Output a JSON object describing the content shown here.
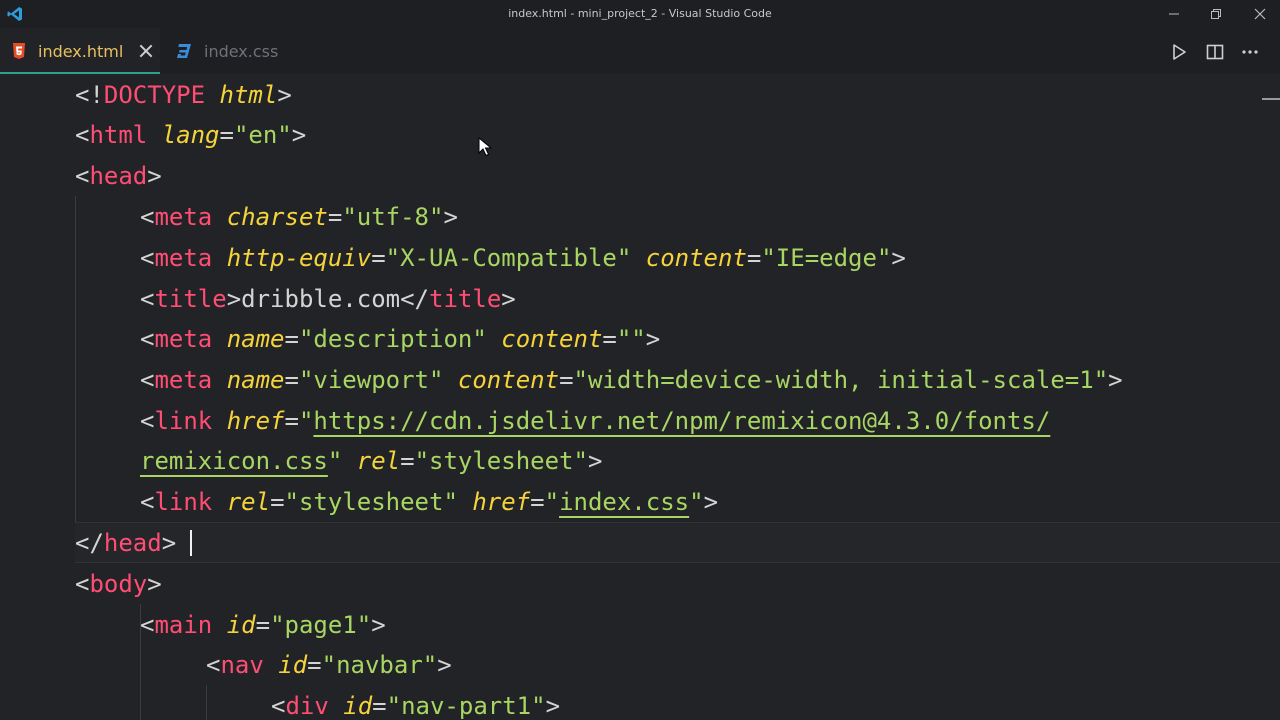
{
  "window": {
    "title": "index.html - mini_project_2 - Visual Studio Code"
  },
  "tabs": [
    {
      "label": "index.html",
      "icon": "html5-icon",
      "active": true
    },
    {
      "label": "index.css",
      "icon": "css3-icon",
      "active": false
    }
  ],
  "colors": {
    "tag": "#ff4d74",
    "attribute": "#f5d33a",
    "string": "#a8d663",
    "punctuation": "#d4d4d4",
    "active_tab_label": "#e8c062",
    "editor_background": "#222326"
  },
  "code": {
    "l1": {
      "open": "<!",
      "tag": "DOCTYPE",
      "sp": " ",
      "attr": "html",
      "close": ">"
    },
    "l2": {
      "open": "<",
      "tag": "html",
      "sp": " ",
      "attr": "lang",
      "eq": "=",
      "val": "\"en\"",
      "close": ">"
    },
    "l3": {
      "open": "<",
      "tag": "head",
      "close": ">"
    },
    "l4": {
      "open": "<",
      "tag": "meta",
      "sp": " ",
      "attr": "charset",
      "eq": "=",
      "val": "\"utf-8\"",
      "close": ">"
    },
    "l5": {
      "open": "<",
      "tag": "meta",
      "sp1": " ",
      "attr1": "http-equiv",
      "eq1": "=",
      "val1": "\"X-UA-Compatible\"",
      "sp2": " ",
      "attr2": "content",
      "eq2": "=",
      "val2": "\"IE=edge\"",
      "close": ">"
    },
    "l6": {
      "open": "<",
      "tag": "title",
      "gt": ">",
      "text": "dribble.com",
      "open2": "</",
      "tag2": "title",
      "close": ">"
    },
    "l7": {
      "open": "<",
      "tag": "meta",
      "sp1": " ",
      "attr1": "name",
      "eq1": "=",
      "val1": "\"description\"",
      "sp2": " ",
      "attr2": "content",
      "eq2": "=",
      "val2": "\"\"",
      "close": ">"
    },
    "l8": {
      "open": "<",
      "tag": "meta",
      "sp1": " ",
      "attr1": "name",
      "eq1": "=",
      "val1": "\"viewport\"",
      "sp2": " ",
      "attr2": "content",
      "eq2": "=",
      "val2": "\"width=device-width, initial-scale=1\"",
      "close": ">"
    },
    "l9": {
      "open": "<",
      "tag": "link",
      "sp": " ",
      "attr": "href",
      "eq": "=",
      "q": "\"",
      "url": "https://cdn.jsdelivr.net/npm/remixicon@4.3.0/fonts/"
    },
    "l10": {
      "url": "remixicon.css",
      "q": "\"",
      "sp": " ",
      "attr": "rel",
      "eq": "=",
      "val": "\"stylesheet\"",
      "close": ">"
    },
    "l11": {
      "open": "<",
      "tag": "link",
      "sp1": " ",
      "attr1": "rel",
      "eq1": "=",
      "val1": "\"stylesheet\"",
      "sp2": " ",
      "attr2": "href",
      "eq2": "=",
      "q1": "\"",
      "url": "index.css",
      "q2": "\"",
      "close": ">"
    },
    "l12": {
      "open": "</",
      "tag": "head",
      "close": ">"
    },
    "l13": {
      "open": "<",
      "tag": "body",
      "close": ">"
    },
    "l14": {
      "open": "<",
      "tag": "main",
      "sp": " ",
      "attr": "id",
      "eq": "=",
      "val": "\"page1\"",
      "close": ">"
    },
    "l15": {
      "open": "<",
      "tag": "nav",
      "sp": " ",
      "attr": "id",
      "eq": "=",
      "val": "\"navbar\"",
      "close": ">"
    },
    "l16": {
      "open": "<",
      "tag": "div",
      "sp": " ",
      "attr": "id",
      "eq": "=",
      "val": "\"nav-part1\"",
      "close": ">"
    }
  }
}
